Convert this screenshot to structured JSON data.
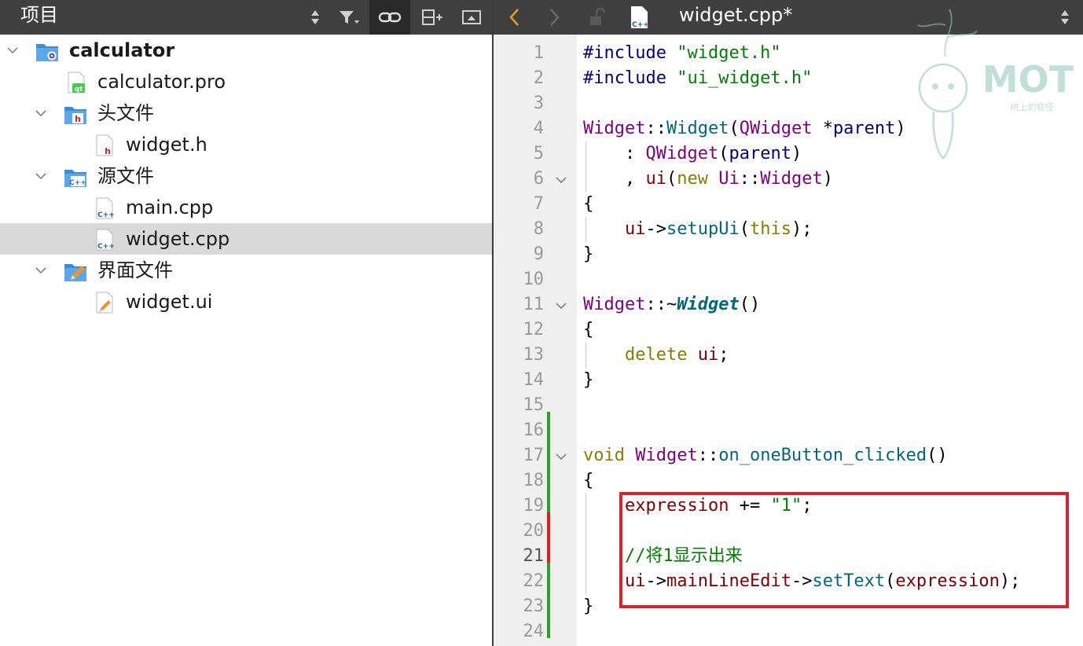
{
  "project_panel": {
    "title": "项目",
    "toolbar_icons": [
      "sort-updown-icon",
      "filter-icon",
      "link-icon",
      "split-add-icon",
      "panel-icon"
    ],
    "tree": [
      {
        "label": "calculator",
        "icon": "qt-project-folder-icon",
        "level": 0,
        "expanded": true,
        "bold": true
      },
      {
        "label": "calculator.pro",
        "icon": "qt-pro-file-icon",
        "level": 1
      },
      {
        "label": "头文件",
        "icon": "header-folder-icon",
        "level": 1,
        "expanded": true
      },
      {
        "label": "widget.h",
        "icon": "header-file-icon",
        "level": 2
      },
      {
        "label": "源文件",
        "icon": "source-folder-icon",
        "level": 1,
        "expanded": true
      },
      {
        "label": "main.cpp",
        "icon": "cpp-file-icon",
        "level": 2
      },
      {
        "label": "widget.cpp",
        "icon": "cpp-file-icon",
        "level": 2,
        "selected": true
      },
      {
        "label": "界面文件",
        "icon": "form-folder-icon",
        "level": 1,
        "expanded": true
      },
      {
        "label": "widget.ui",
        "icon": "ui-file-icon",
        "level": 2
      }
    ]
  },
  "editor": {
    "file_name": "widget.cpp*",
    "toolbar_icons": [
      "back-arrow-icon",
      "forward-arrow-icon",
      "lock-icon",
      "cpp-file-icon",
      "sort-updown-icon"
    ],
    "current_line": 21,
    "line_numbers": [
      "1",
      "2",
      "3",
      "4",
      "5",
      "6",
      "7",
      "8",
      "9",
      "10",
      "11",
      "12",
      "13",
      "14",
      "15",
      "16",
      "17",
      "18",
      "19",
      "20",
      "21",
      "22",
      "23",
      "24"
    ],
    "lines": [
      "#include \"widget.h\"",
      "#include \"ui_widget.h\"",
      "",
      "Widget::Widget(QWidget *parent)",
      "    : QWidget(parent)",
      "    , ui(new Ui::Widget)",
      "{",
      "    ui->setupUi(this);",
      "}",
      "",
      "Widget::~Widget()",
      "{",
      "    delete ui;",
      "}",
      "",
      "",
      "void Widget::on_oneButton_clicked()",
      "{",
      "    expression += \"1\";",
      "",
      "    //将1显示出来",
      "    ui->mainLineEdit->setText(expression);",
      "}",
      ""
    ],
    "fold_lines": [
      6,
      11,
      17
    ],
    "changed_green_lines": [
      16,
      17,
      18,
      19,
      22,
      23,
      24
    ],
    "changed_red_lines": [
      20,
      21
    ],
    "highlight_color": "#d9222b"
  },
  "watermark": {
    "text": "MOT",
    "subtext": "树上的铁怪"
  }
}
